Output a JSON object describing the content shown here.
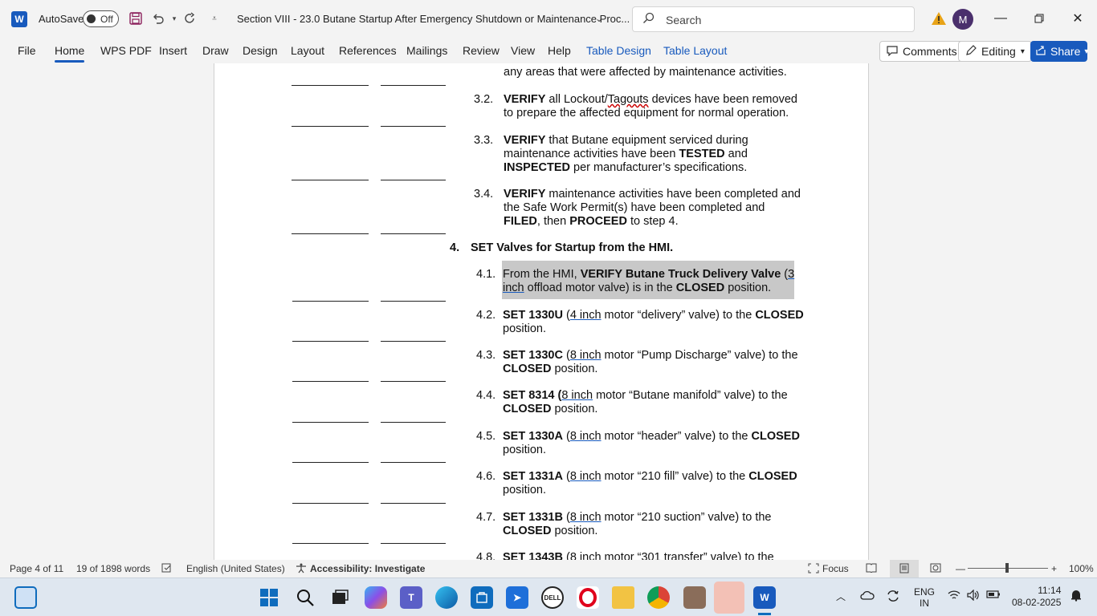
{
  "titlebar": {
    "app_logo": "W",
    "autosave_label": "AutoSave",
    "autosave_state": "Off",
    "doc_title": "Section VIII - 23.0 Butane Startup After Emergency Shutdown or Maintenance Proc...",
    "search_placeholder": "Search",
    "avatar_initial": "M"
  },
  "ribbon": {
    "tabs": [
      "File",
      "Home",
      "WPS PDF",
      "Insert",
      "Draw",
      "Design",
      "Layout",
      "References",
      "Mailings",
      "Review",
      "View",
      "Help",
      "Table Design",
      "Table Layout"
    ],
    "active_tab": "Home",
    "comments_label": "Comments",
    "editing_label": "Editing",
    "share_label": "Share"
  },
  "document": {
    "partial_top": "any areas that were affected by maintenance activities.",
    "steps": [
      {
        "num": "3.2.",
        "lines": [
          [
            "VERIFY",
            " all Lockout/",
            "Tagouts",
            " devices have been removed"
          ],
          [
            "to prepare the affected equipment for normal operation."
          ]
        ]
      },
      {
        "num": "3.3.",
        "l1a": "VERIFY",
        "l1b": " that Butane equipment serviced during",
        "l2a": "maintenance activities have been ",
        "l2b": "TESTED",
        "l2c": " and",
        "l3a": "INSPECTED",
        "l3b": " per manufacturer’s specifications."
      },
      {
        "num": "3.4.",
        "l1a": "VERIFY",
        "l1b": " maintenance activities have been completed and",
        "l2": "the Safe Work Permit(s) have been completed and",
        "l3a": "FILED",
        "l3b": ", then ",
        "l3c": "PROCEED",
        "l3d": " to step 4."
      }
    ],
    "section4": {
      "num": "4.",
      "title": "SET Valves for Startup from the HMI."
    },
    "s41": {
      "num": "4.1.",
      "a": "From the HMI, ",
      "b": "VERIFY Butane Truck Delivery Valve",
      "c": " (",
      "d": "3",
      "e": "inch",
      "f": " offload motor valve) is in the ",
      "g": "CLOSED",
      "h": " position."
    },
    "s42": {
      "num": "4.2.",
      "a": "SET 1330U",
      "b": " (",
      "c": "4 inch",
      "d": " motor “delivery” valve) to the ",
      "e": "CLOSED",
      "f": "position."
    },
    "s43": {
      "num": "4.3.",
      "a": "SET 1330C",
      "b": " (",
      "c": "8 inch",
      "d": " motor “Pump Discharge” valve) to the",
      "e": "CLOSED",
      "f": " position."
    },
    "s44": {
      "num": "4.4.",
      "a": "SET 8314 (",
      "c": "8 inch",
      "d": " motor “Butane manifold” valve) to the",
      "e": "CLOSED",
      "f": " position."
    },
    "s45": {
      "num": "4.5.",
      "a": "SET 1330A",
      "b": " (",
      "c": "8 inch",
      "d": " motor “header” valve) to the ",
      "e": "CLOSED",
      "f": "position."
    },
    "s46": {
      "num": "4.6.",
      "a": "SET 1331A",
      "b": " (",
      "c": "8 inch",
      "d": " motor “210 fill” valve) to the ",
      "e": "CLOSED",
      "f": "position."
    },
    "s47": {
      "num": "4.7.",
      "a": "SET 1331B",
      "b": " (",
      "c": "8 inch",
      "d": " motor “210 suction” valve) to the",
      "e": "CLOSED",
      "f": " position."
    },
    "s48": {
      "num": "4.8.",
      "a": "SET 1343B",
      "b": " (8 inch motor “301 transfer” valve) to the"
    }
  },
  "status": {
    "page": "Page 4 of 11",
    "words": "19 of 1898 words",
    "language": "English (United States)",
    "accessibility": "Accessibility: Investigate",
    "focus": "Focus",
    "zoom": "100%"
  },
  "taskbar": {
    "lang1": "ENG",
    "lang2": "IN",
    "time": "11:14",
    "date": "08-02-2025"
  }
}
